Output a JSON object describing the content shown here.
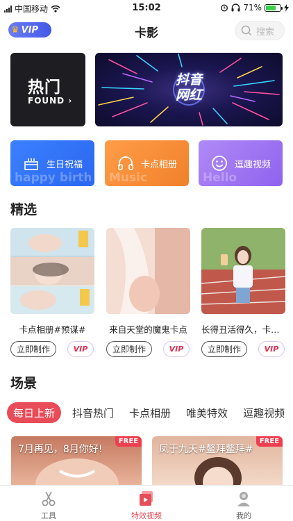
{
  "status_bar": {
    "carrier": "中国移动",
    "time": "15:02",
    "battery": "71%",
    "battery_level": 0.71
  },
  "nav": {
    "vip_label": "VIP",
    "title": "卡影",
    "search_placeholder": "搜索"
  },
  "banners": {
    "hot": {
      "title": "热门",
      "subtitle": "FOUND"
    },
    "star": {
      "title_line1": "抖音",
      "title_line2": "网红"
    }
  },
  "categories": [
    {
      "label": "生日祝福",
      "watermark": "happy birth",
      "icon": "birthday-cake-icon"
    },
    {
      "label": "卡点相册",
      "watermark": "Music",
      "icon": "headphones-icon"
    },
    {
      "label": "逗趣视频",
      "watermark": "Hello",
      "icon": "smiley-icon"
    }
  ],
  "featured": {
    "title": "精选",
    "items": [
      {
        "name": "卡点相册#预谋#",
        "button": "立即制作",
        "badge": "VIP"
      },
      {
        "name": "来自天堂的魔鬼卡点",
        "button": "立即制作",
        "badge": "VIP"
      },
      {
        "name": "长得丑活得久，卡点...",
        "button": "立即制作",
        "badge": "VIP"
      }
    ]
  },
  "scenes": {
    "title": "场景",
    "tabs": [
      "每日上新",
      "抖音热门",
      "卡点相册",
      "唯美特效",
      "逗趣视频"
    ],
    "active_tab": "每日上新",
    "cards": [
      {
        "caption": "7月再见，8月你好!",
        "badge": "FREE"
      },
      {
        "caption": "凤于九天#鳌拜鳌拜#",
        "badge": "FREE"
      }
    ]
  },
  "tab_bar": [
    {
      "label": "工具",
      "icon": "scissors-icon"
    },
    {
      "label": "特效视频",
      "icon": "video-play-icon",
      "active": true
    },
    {
      "label": "我的",
      "icon": "profile-icon"
    }
  ],
  "colors": {
    "accent": "#e84c58",
    "vip_blue": "#4458e8",
    "blue_card": "#2b67f0",
    "orange_card": "#f1812b",
    "purple_card": "#8f62ee"
  }
}
